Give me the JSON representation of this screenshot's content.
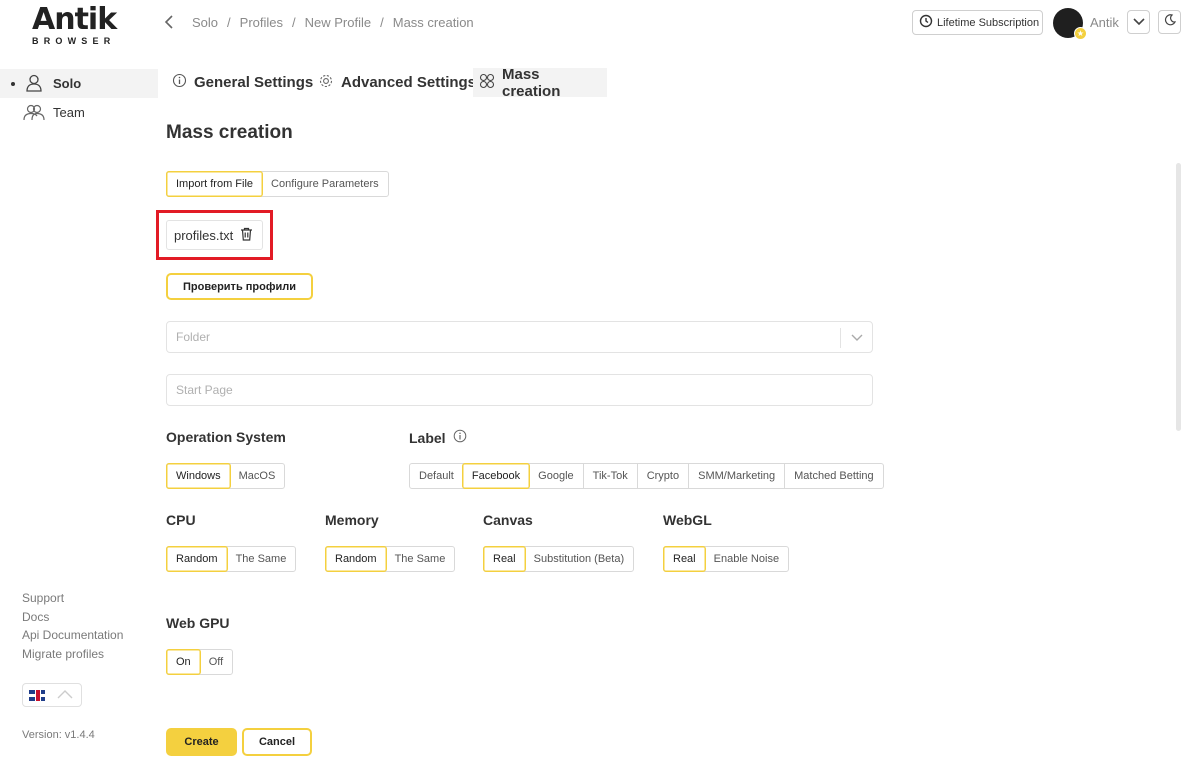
{
  "logo": {
    "name": "Antik",
    "sub": "BROWSER"
  },
  "breadcrumb": [
    "Solo",
    "Profiles",
    "New Profile",
    "Mass creation"
  ],
  "header": {
    "subscription": "Lifetime Subscription",
    "user": "Antik"
  },
  "sidebar": {
    "items": [
      {
        "label": "Solo",
        "active": true,
        "icon": "user-icon"
      },
      {
        "label": "Team",
        "active": false,
        "icon": "users-icon"
      }
    ],
    "links": [
      "Support",
      "Docs",
      "Api Documentation",
      "Migrate profiles"
    ],
    "language_icon": "uk-flag-icon",
    "version": "Version: v1.4.4"
  },
  "tabs": [
    {
      "label": "General Settings",
      "icon": "info-icon",
      "active": false
    },
    {
      "label": "Advanced Settings",
      "icon": "gear-icon",
      "active": false
    },
    {
      "label": "Mass creation",
      "icon": "grid-icon",
      "active": true
    }
  ],
  "page_title": "Mass creation",
  "import_mode": {
    "options": [
      "Import from File",
      "Configure Parameters"
    ],
    "selected": "Import from File"
  },
  "file": {
    "name": "profiles.txt"
  },
  "check_button": "Проверить профили",
  "folder": {
    "placeholder": "Folder"
  },
  "start_page": {
    "placeholder": "Start Page"
  },
  "operation_system": {
    "label": "Operation System",
    "options": [
      "Windows",
      "MacOS"
    ],
    "selected": "Windows"
  },
  "label_group": {
    "label": "Label",
    "options": [
      "Default",
      "Facebook",
      "Google",
      "Tik-Tok",
      "Crypto",
      "SMM/Marketing",
      "Matched Betting"
    ],
    "selected": "Facebook"
  },
  "cpu": {
    "label": "CPU",
    "options": [
      "Random",
      "The Same"
    ],
    "selected": "Random"
  },
  "memory": {
    "label": "Memory",
    "options": [
      "Random",
      "The Same"
    ],
    "selected": "Random"
  },
  "canvas": {
    "label": "Canvas",
    "options": [
      "Real",
      "Substitution (Beta)"
    ],
    "selected": "Real"
  },
  "webgl": {
    "label": "WebGL",
    "options": [
      "Real",
      "Enable Noise"
    ],
    "selected": "Real"
  },
  "webgpu": {
    "label": "Web GPU",
    "options": [
      "On",
      "Off"
    ],
    "selected": "On"
  },
  "actions": {
    "create": "Create",
    "cancel": "Cancel"
  },
  "colors": {
    "accent": "#f4d03f",
    "highlight_box": "#e21b25"
  }
}
